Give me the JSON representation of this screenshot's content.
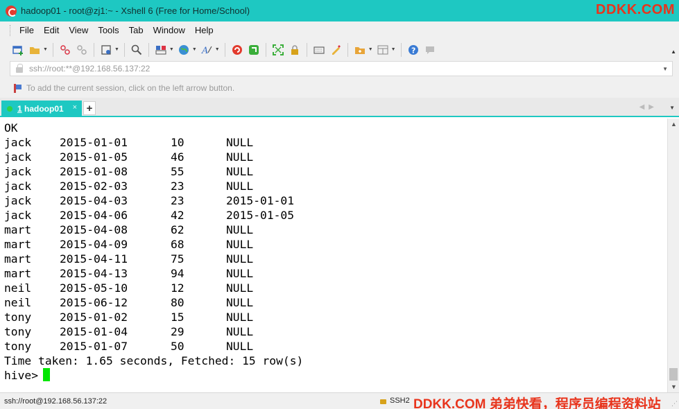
{
  "window": {
    "title": "hadoop01 - root@zj1:~ - Xshell 6 (Free for Home/School)"
  },
  "watermark": {
    "top": "DDKK.COM",
    "bottom": "DDKK.COM 弟弟快看，程序员编程资料站"
  },
  "menu": {
    "items": [
      "File",
      "Edit",
      "View",
      "Tools",
      "Tab",
      "Window",
      "Help"
    ]
  },
  "address": {
    "value": "ssh://root:**@192.168.56.137:22"
  },
  "hint": {
    "text": "To add the current session, click on the left arrow button."
  },
  "tabs": {
    "active_number": "1",
    "active_label": " hadoop01",
    "close": "×",
    "add": "+"
  },
  "terminal": {
    "header": "OK",
    "rows": [
      [
        "jack",
        "2015-01-01",
        "10",
        "NULL"
      ],
      [
        "jack",
        "2015-01-05",
        "46",
        "NULL"
      ],
      [
        "jack",
        "2015-01-08",
        "55",
        "NULL"
      ],
      [
        "jack",
        "2015-02-03",
        "23",
        "NULL"
      ],
      [
        "jack",
        "2015-04-03",
        "23",
        "2015-01-01"
      ],
      [
        "jack",
        "2015-04-06",
        "42",
        "2015-01-05"
      ],
      [
        "mart",
        "2015-04-08",
        "62",
        "NULL"
      ],
      [
        "mart",
        "2015-04-09",
        "68",
        "NULL"
      ],
      [
        "mart",
        "2015-04-11",
        "75",
        "NULL"
      ],
      [
        "mart",
        "2015-04-13",
        "94",
        "NULL"
      ],
      [
        "neil",
        "2015-05-10",
        "12",
        "NULL"
      ],
      [
        "neil",
        "2015-06-12",
        "80",
        "NULL"
      ],
      [
        "tony",
        "2015-01-02",
        "15",
        "NULL"
      ],
      [
        "tony",
        "2015-01-04",
        "29",
        "NULL"
      ],
      [
        "tony",
        "2015-01-07",
        "50",
        "NULL"
      ]
    ],
    "summary": "Time taken: 1.65 seconds, Fetched: 15 row(s)",
    "prompt": "hive>"
  },
  "status": {
    "connection": "ssh://root@192.168.56.137:22",
    "protocol": "SSH2"
  },
  "colors": {
    "accent": "#1ec8c2",
    "cursor": "#00e600",
    "watermark": "#e8341c"
  }
}
